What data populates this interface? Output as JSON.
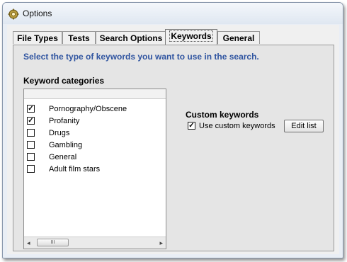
{
  "window": {
    "title": "Options",
    "icon": "gear-icon"
  },
  "tabs": [
    {
      "label": "File Types",
      "active": false
    },
    {
      "label": "Tests",
      "active": false
    },
    {
      "label": "Search Options",
      "active": false
    },
    {
      "label": "Keywords",
      "active": true
    },
    {
      "label": "General",
      "active": false
    }
  ],
  "keywords_panel": {
    "instruction": "Select the type of keywords you want to use in the search.",
    "categories_label": "Keyword categories",
    "categories": [
      {
        "label": "Pornography/Obscene",
        "checked": true
      },
      {
        "label": "Profanity",
        "checked": true
      },
      {
        "label": "Drugs",
        "checked": false
      },
      {
        "label": "Gambling",
        "checked": false
      },
      {
        "label": "General",
        "checked": false
      },
      {
        "label": "Adult film stars",
        "checked": false
      }
    ],
    "scrollbar": {
      "left_arrow": "◂",
      "right_arrow": "▸",
      "thumb_grip": "III"
    },
    "custom": {
      "section_label": "Custom keywords",
      "use_custom_label": "Use custom keywords",
      "use_custom_checked": true,
      "edit_button_label": "Edit list"
    }
  },
  "colors": {
    "instruction_text": "#2f54a0"
  }
}
